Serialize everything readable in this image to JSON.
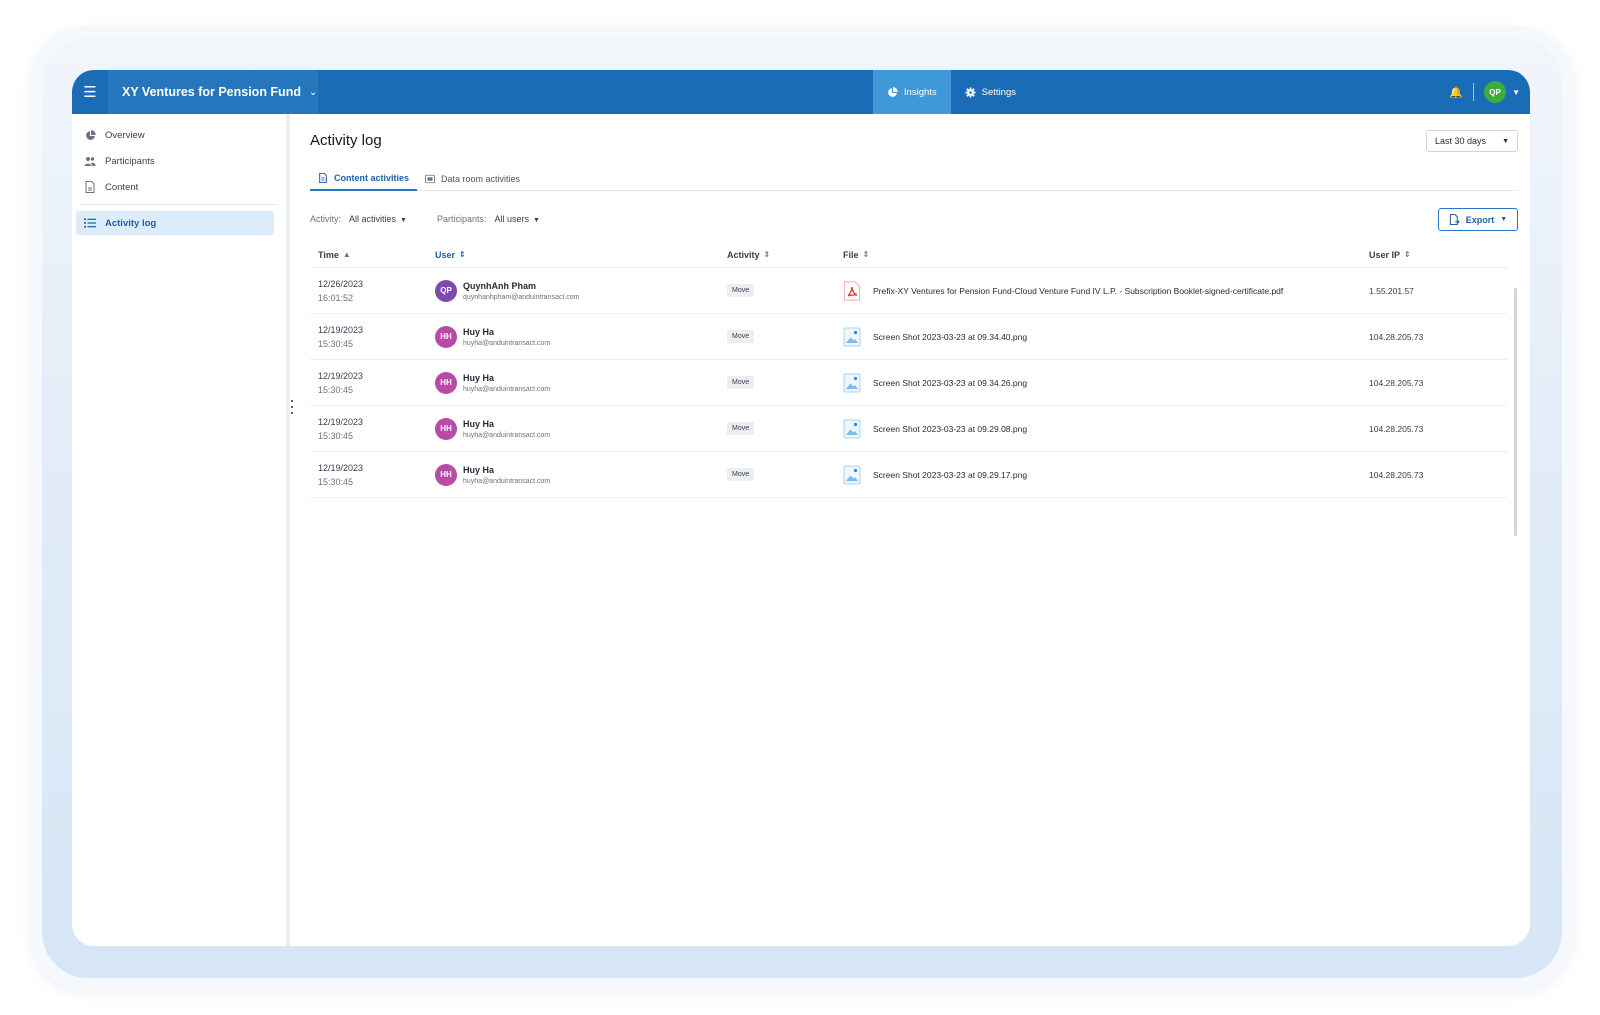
{
  "topbar": {
    "menu_icon": "hamburger-icon",
    "fund_name": "XY Ventures for Pension Fund",
    "nav": [
      {
        "label": "Insights",
        "icon": "pie-chart-icon",
        "active": true
      },
      {
        "label": "Settings",
        "icon": "gear-icon",
        "active": false
      }
    ],
    "notification_icon": "bell-settings-icon",
    "user_initials": "QP"
  },
  "sidebar": {
    "items": [
      {
        "label": "Overview",
        "icon": "pie-chart-icon"
      },
      {
        "label": "Participants",
        "icon": "users-icon"
      },
      {
        "label": "Content",
        "icon": "document-icon"
      },
      {
        "label": "Activity log",
        "icon": "list-icon",
        "active": true
      }
    ]
  },
  "main": {
    "title": "Activity log",
    "date_range": "Last 30 days",
    "tabs": [
      {
        "label": "Content activities",
        "active": true
      },
      {
        "label": "Data room activities",
        "active": false
      }
    ],
    "filters": {
      "activity_label": "Activity:",
      "activity_value": "All activities",
      "participants_label": "Participants:",
      "participants_value": "All users"
    },
    "export_label": "Export",
    "columns": {
      "time": "Time",
      "user": "User",
      "activity": "Activity",
      "file": "File",
      "ip": "User IP"
    },
    "rows": [
      {
        "date": "12/26/2023",
        "time": "16:01:52",
        "initials": "QP",
        "avatar_color": "#7d4bab",
        "name": "QuynhAnh Pham",
        "email": "quynhanhpham@anduintransact.com",
        "activity": "Move",
        "file_type": "pdf",
        "file": "Prefix-XY Ventures for Pension Fund-Cloud Venture Fund IV L.P. - Subscription Booklet-signed-certificate.pdf",
        "ip": "1.55.201.57"
      },
      {
        "date": "12/19/2023",
        "time": "15:30:45",
        "initials": "HH",
        "avatar_color": "#b94aa6",
        "name": "Huy Ha",
        "email": "huyha@anduintransact.com",
        "activity": "Move",
        "file_type": "image",
        "file": "Screen Shot 2023-03-23 at 09.34.40.png",
        "ip": "104.28.205.73"
      },
      {
        "date": "12/19/2023",
        "time": "15:30:45",
        "initials": "HH",
        "avatar_color": "#b94aa6",
        "name": "Huy Ha",
        "email": "huyha@anduintransact.com",
        "activity": "Move",
        "file_type": "image",
        "file": "Screen Shot 2023-03-23 at 09.34.26.png",
        "ip": "104.28.205.73"
      },
      {
        "date": "12/19/2023",
        "time": "15:30:45",
        "initials": "HH",
        "avatar_color": "#b94aa6",
        "name": "Huy Ha",
        "email": "huyha@anduintransact.com",
        "activity": "Move",
        "file_type": "image",
        "file": "Screen Shot 2023-03-23 at 09.29.08.png",
        "ip": "104.28.205.73"
      },
      {
        "date": "12/19/2023",
        "time": "15:30:45",
        "initials": "HH",
        "avatar_color": "#b94aa6",
        "name": "Huy Ha",
        "email": "huyha@anduintransact.com",
        "activity": "Move",
        "file_type": "image",
        "file": "Screen Shot 2023-03-23 at 09.29.17.png",
        "ip": "104.28.205.73"
      }
    ]
  },
  "colors": {
    "topbar": "#1a6cb6",
    "accent": "#1f5fa3",
    "active_nav": "#3f98d8",
    "user_avatar": "#3aad3d"
  }
}
